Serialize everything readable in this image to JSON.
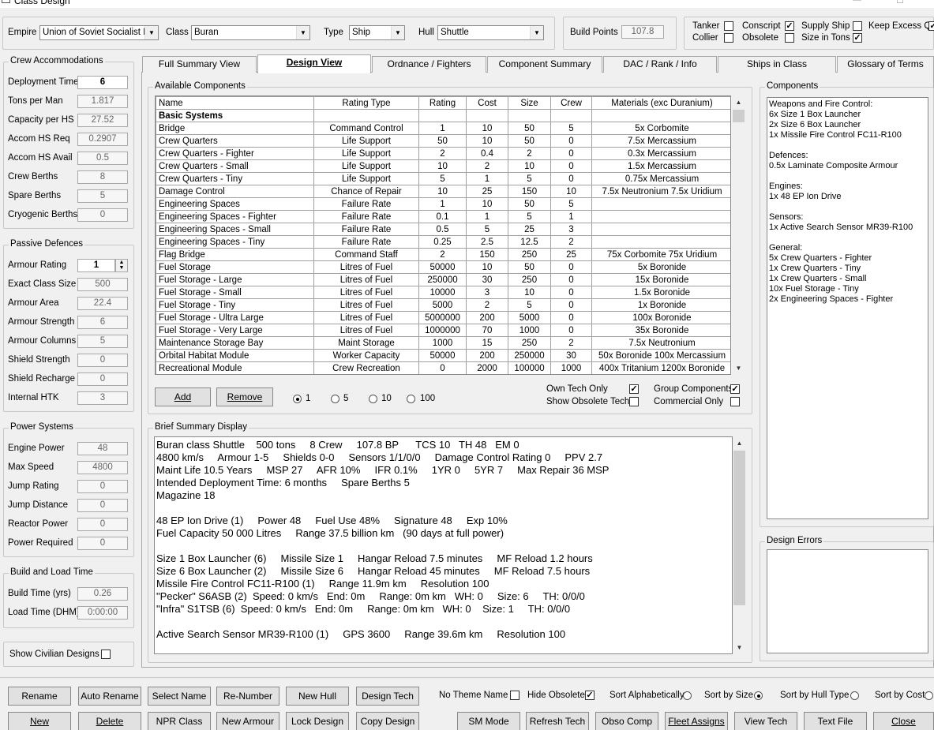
{
  "window": {
    "title": "Class Design",
    "min": "—",
    "max": "☐",
    "close": "✕"
  },
  "top": {
    "empire_label": "Empire",
    "empire_value": "Union of Soviet Socialist Re",
    "class_label": "Class",
    "class_value": "Buran",
    "type_label": "Type",
    "type_value": "Ship",
    "hull_label": "Hull",
    "hull_value": "Shuttle",
    "bp_label": "Build Points",
    "bp_value": "107.8",
    "flags": [
      {
        "label": "Tanker",
        "checked": false
      },
      {
        "label": "Conscript",
        "checked": false
      },
      {
        "label": "Supply Ship",
        "checked": true
      },
      {
        "label": "Keep Excess Q",
        "checked": false
      },
      {
        "label": "Collier",
        "checked": false
      },
      {
        "label": "Obsolete",
        "checked": false
      },
      {
        "label": "Size in Tons",
        "checked": true
      }
    ]
  },
  "crew": {
    "title": "Crew Accommodations",
    "rows": [
      {
        "label": "Deployment Time",
        "value": "6"
      },
      {
        "label": "Tons per Man",
        "value": "1.817"
      },
      {
        "label": "Capacity per HS",
        "value": "27.52"
      },
      {
        "label": "Accom HS Req",
        "value": "0.2907"
      },
      {
        "label": "Accom HS Avail",
        "value": "0.5"
      },
      {
        "label": "Crew Berths",
        "value": "8"
      },
      {
        "label": "Spare Berths",
        "value": "5"
      },
      {
        "label": "Cryogenic Berths",
        "value": "0"
      }
    ]
  },
  "passive": {
    "title": "Passive Defences",
    "rows": [
      {
        "label": "Armour Rating",
        "value": "1"
      },
      {
        "label": "Exact Class Size",
        "value": "500"
      },
      {
        "label": "Armour Area",
        "value": "22.4"
      },
      {
        "label": "Armour Strength",
        "value": "6"
      },
      {
        "label": "Armour Columns",
        "value": "5"
      },
      {
        "label": "Shield Strength",
        "value": "0"
      },
      {
        "label": "Shield Recharge",
        "value": "0"
      },
      {
        "label": "Internal HTK",
        "value": "3"
      }
    ]
  },
  "power": {
    "title": "Power Systems",
    "rows": [
      {
        "label": "Engine Power",
        "value": "48"
      },
      {
        "label": "Max Speed",
        "value": "4800"
      },
      {
        "label": "Jump Rating",
        "value": "0"
      },
      {
        "label": "Jump Distance",
        "value": "0"
      },
      {
        "label": "Reactor Power",
        "value": "0"
      },
      {
        "label": "Power Required",
        "value": "0"
      }
    ]
  },
  "build": {
    "title": "Build and Load Time",
    "rows": [
      {
        "label": "Build Time (yrs)",
        "value": "0.26"
      },
      {
        "label": "Load Time (DHM)",
        "value": "0:00:00"
      }
    ]
  },
  "show_civilian": "Show Civilian Designs",
  "tabs": [
    "Full Summary View",
    "Design View",
    "Ordnance / Fighters",
    "Component Summary",
    "DAC / Rank / Info",
    "Ships in Class",
    "Glossary of Terms"
  ],
  "available": {
    "title": "Available Components",
    "headers": [
      "Name",
      "Rating Type",
      "Rating",
      "Cost",
      "Size",
      "Crew",
      "Materials (exc Duranium)"
    ],
    "section": "Basic Systems",
    "rows": [
      [
        "Bridge",
        "Command Control",
        "1",
        "10",
        "50",
        "5",
        "5x Corbomite"
      ],
      [
        "Crew Quarters",
        "Life Support",
        "50",
        "10",
        "50",
        "0",
        "7.5x Mercassium"
      ],
      [
        "Crew Quarters - Fighter",
        "Life Support",
        "2",
        "0.4",
        "2",
        "0",
        "0.3x Mercassium"
      ],
      [
        "Crew Quarters - Small",
        "Life Support",
        "10",
        "2",
        "10",
        "0",
        "1.5x Mercassium"
      ],
      [
        "Crew Quarters - Tiny",
        "Life Support",
        "5",
        "1",
        "5",
        "0",
        "0.75x Mercassium"
      ],
      [
        "Damage Control",
        "Chance of Repair",
        "10",
        "25",
        "150",
        "10",
        "7.5x Neutronium  7.5x Uridium"
      ],
      [
        "Engineering Spaces",
        "Failure Rate",
        "1",
        "10",
        "50",
        "5",
        ""
      ],
      [
        "Engineering Spaces - Fighter",
        "Failure Rate",
        "0.1",
        "1",
        "5",
        "1",
        ""
      ],
      [
        "Engineering Spaces - Small",
        "Failure Rate",
        "0.5",
        "5",
        "25",
        "3",
        ""
      ],
      [
        "Engineering Spaces - Tiny",
        "Failure Rate",
        "0.25",
        "2.5",
        "12.5",
        "2",
        ""
      ],
      [
        "Flag Bridge",
        "Command Staff",
        "2",
        "150",
        "250",
        "25",
        "75x Corbomite  75x Uridium"
      ],
      [
        "Fuel Storage",
        "Litres of Fuel",
        "50000",
        "10",
        "50",
        "0",
        "5x Boronide"
      ],
      [
        "Fuel Storage - Large",
        "Litres of Fuel",
        "250000",
        "30",
        "250",
        "0",
        "15x Boronide"
      ],
      [
        "Fuel Storage - Small",
        "Litres of Fuel",
        "10000",
        "3",
        "10",
        "0",
        "1.5x Boronide"
      ],
      [
        "Fuel Storage - Tiny",
        "Litres of Fuel",
        "5000",
        "2",
        "5",
        "0",
        "1x Boronide"
      ],
      [
        "Fuel Storage - Ultra Large",
        "Litres of Fuel",
        "5000000",
        "200",
        "5000",
        "0",
        "100x Boronide"
      ],
      [
        "Fuel Storage - Very Large",
        "Litres of Fuel",
        "1000000",
        "70",
        "1000",
        "0",
        "35x Boronide"
      ],
      [
        "Maintenance Storage Bay",
        "Maint Storage",
        "1000",
        "15",
        "250",
        "2",
        "7.5x Neutronium"
      ],
      [
        "Orbital Habitat Module",
        "Worker Capacity",
        "50000",
        "200",
        "250000",
        "30",
        "50x Boronide  100x Mercassium"
      ],
      [
        "Recreational Module",
        "Crew Recreation",
        "0",
        "2000",
        "100000",
        "1000",
        "400x Tritanium  1200x Boronide"
      ]
    ],
    "add": "Add",
    "remove": "Remove",
    "qty": [
      "1",
      "5",
      "10",
      "100"
    ],
    "own_tech": "Own Tech Only",
    "show_obsolete_tech": "Show Obsolete Tech",
    "group_components": "Group Components",
    "commercial_only": "Commercial Only"
  },
  "brief": {
    "title": "Brief Summary Display",
    "text": "Buran class Shuttle    500 tons     8 Crew     107.8 BP      TCS 10   TH 48   EM 0\n4800 km/s     Armour 1-5     Shields 0-0     Sensors 1/1/0/0     Damage Control Rating 0     PPV 2.7\nMaint Life 10.5 Years     MSP 27     AFR 10%     IFR 0.1%     1YR 0     5YR 7     Max Repair 36 MSP\nIntended Deployment Time: 6 months     Spare Berths 5\nMagazine 18\n\n48 EP Ion Drive (1)     Power 48     Fuel Use 48%     Signature 48     Exp 10%\nFuel Capacity 50 000 Litres     Range 37.5 billion km   (90 days at full power)\n\nSize 1 Box Launcher (6)     Missile Size 1     Hangar Reload 7.5 minutes     MF Reload 1.2 hours\nSize 6 Box Launcher (2)     Missile Size 6     Hangar Reload 45 minutes     MF Reload 7.5 hours\nMissile Fire Control FC11-R100 (1)     Range 11.9m km     Resolution 100\n\"Pecker\" S6ASB (2)  Speed: 0 km/s   End: 0m     Range: 0m km   WH: 0     Size: 6     TH: 0/0/0\n\"Infra\" S1TSB (6)  Speed: 0 km/s   End: 0m     Range: 0m km   WH: 0    Size: 1     TH: 0/0/0\n\nActive Search Sensor MR39-R100 (1)     GPS 3600     Range 39.6m km     Resolution 100"
  },
  "components": {
    "title": "Components",
    "text": "Weapons and Fire Control:\n6x Size 1 Box Launcher\n2x Size 6 Box Launcher\n1x Missile Fire Control FC11-R100\n\nDefences:\n0.5x Laminate Composite Armour\n\nEngines:\n1x 48 EP Ion Drive\n\nSensors:\n1x Active Search Sensor MR39-R100\n\nGeneral:\n5x Crew Quarters - Fighter\n1x Crew Quarters - Tiny\n1x Crew Quarters - Small\n10x Fuel Storage - Tiny\n2x Engineering Spaces - Fighter"
  },
  "design_errors": {
    "title": "Design Errors"
  },
  "bottom": {
    "row1": [
      "Rename",
      "Auto Rename",
      "Select Name",
      "Re-Number",
      "New Hull",
      "Design Tech"
    ],
    "row2": [
      "New",
      "Delete",
      "NPR Class",
      "New Armour",
      "Lock Design",
      "Copy Design",
      "SM Mode",
      "Refresh Tech",
      "Obso Comp",
      "Fleet Assigns",
      "View Tech",
      "Text File",
      "Close"
    ],
    "no_theme": "No Theme Name",
    "hide_obsolete": "Hide Obsolete",
    "sort": [
      "Sort Alphabetically",
      "Sort by Size",
      "Sort by Hull Type",
      "Sort by Cost"
    ]
  }
}
